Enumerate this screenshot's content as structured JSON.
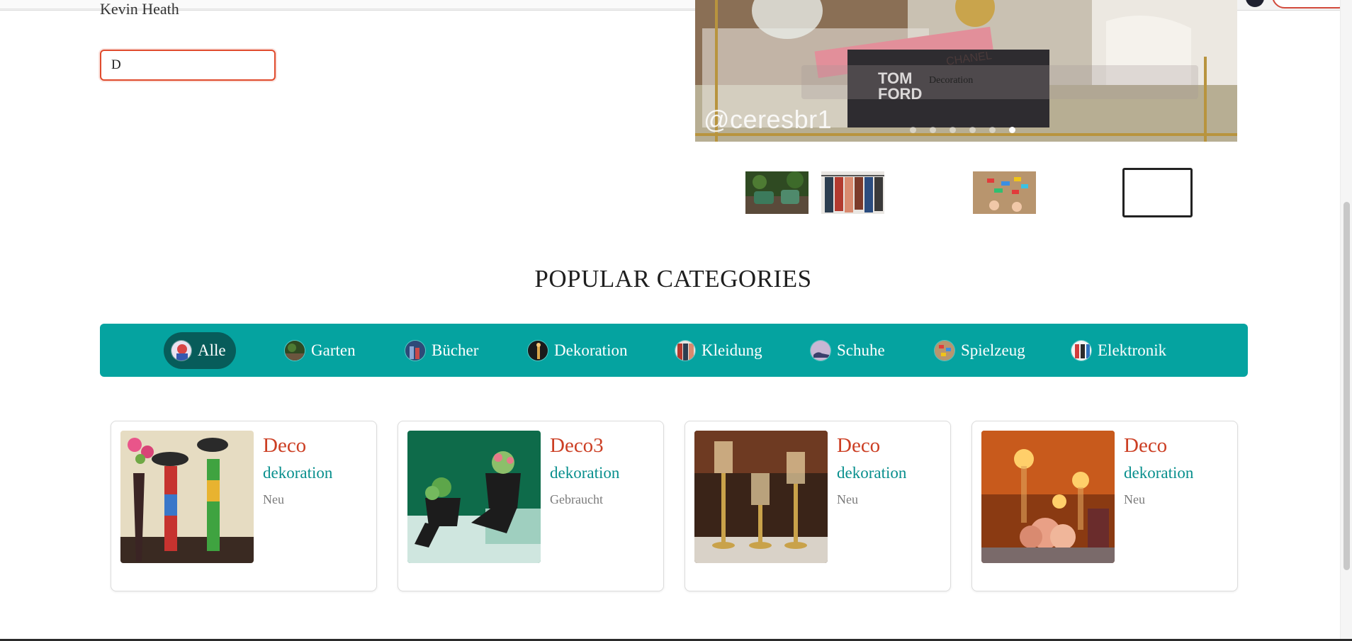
{
  "header": {
    "accent_color": "#d24a3c"
  },
  "listing": {
    "author": "Kevin Heath",
    "input_value": "D"
  },
  "hero": {
    "watermark": "@ceresbr1",
    "caption": "Decoration",
    "slide_count": 6,
    "active_slide": 6
  },
  "section": {
    "title": "POPULAR CATEGORIES"
  },
  "categories": [
    {
      "label": "Alle",
      "active": true,
      "icon": "all-categories-icon"
    },
    {
      "label": "Garten",
      "icon": "garden-icon"
    },
    {
      "label": "Bücher",
      "icon": "books-icon"
    },
    {
      "label": "Dekoration",
      "icon": "decoration-icon"
    },
    {
      "label": "Kleidung",
      "icon": "clothing-icon"
    },
    {
      "label": "Schuhe",
      "icon": "shoes-icon"
    },
    {
      "label": "Spielzeug",
      "icon": "toys-icon"
    },
    {
      "label": "Elektronik",
      "icon": "electronics-icon"
    }
  ],
  "products": [
    {
      "title": "Deco",
      "category": "dekoration",
      "condition": "Neu"
    },
    {
      "title": "Deco3",
      "category": "dekoration",
      "condition": "Gebraucht"
    },
    {
      "title": "Deco",
      "category": "dekoration",
      "condition": "Neu"
    },
    {
      "title": "Deco",
      "category": "dekoration",
      "condition": "Neu"
    }
  ],
  "colors": {
    "teal": "#05a3a0",
    "teal_dark": "#075c5a",
    "title_red": "#cc3f24",
    "category_teal": "#088f8d"
  }
}
